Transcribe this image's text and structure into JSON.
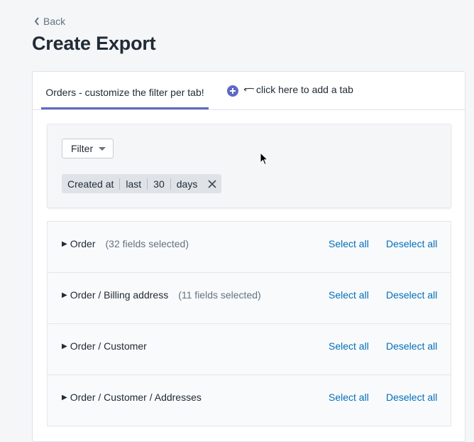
{
  "nav": {
    "back_label": "Back"
  },
  "page": {
    "title": "Create Export"
  },
  "tabs": {
    "active_label": "Orders - customize the filter per tab!",
    "add_hint": "click here to add a tab"
  },
  "filter": {
    "button_label": "Filter",
    "chip": {
      "field": "Created at",
      "operator": "last",
      "value": "30",
      "unit": "days"
    }
  },
  "sections": [
    {
      "label": "Order",
      "count": "(32 fields selected)"
    },
    {
      "label": "Order / Billing address",
      "count": "(11 fields selected)"
    },
    {
      "label": "Order / Customer",
      "count": ""
    },
    {
      "label": "Order / Customer / Addresses",
      "count": ""
    }
  ],
  "actions": {
    "select_all": "Select all",
    "deselect_all": "Deselect all"
  },
  "colors": {
    "accent": "#5c6ac4",
    "link": "#006fbb",
    "background": "#f4f6f8"
  }
}
